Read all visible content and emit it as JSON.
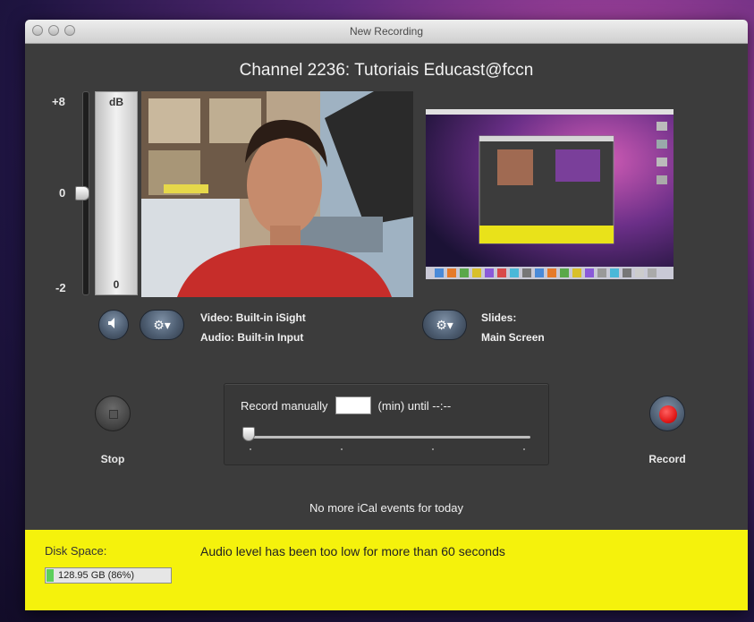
{
  "window": {
    "title": "New Recording"
  },
  "channel": {
    "title": "Channel 2236: Tutoriais Educast@fccn"
  },
  "meter": {
    "top_label": "+8",
    "mid_label": "0",
    "bottom_label": "-2",
    "bar_top": "dB",
    "bar_bottom": "0"
  },
  "video": {
    "line1_label": "Video:",
    "line1_value": "Built-in iSight",
    "line2_label": "Audio:",
    "line2_value": "Built-in Input"
  },
  "slides": {
    "label": "Slides:",
    "value": "Main Screen"
  },
  "controls": {
    "stop_label": "Stop",
    "record_label": "Record",
    "record_manually": "Record manually",
    "minutes_value": "",
    "min_until": "(min) until --:--"
  },
  "ical_text": "No more iCal events for today",
  "status": {
    "disk_label": "Disk Space:",
    "disk_value": "128.95 GB (86%)",
    "disk_fraction": 0.86,
    "warning": "Audio level has been too low for more than 60 seconds"
  },
  "colors": {
    "status_bg": "#f5f20c",
    "record_red": "#e21b1b",
    "disk_green": "#5ccf5c"
  },
  "icons": {
    "speaker": "speaker-icon",
    "gear": "gear-icon",
    "stop": "stop-icon",
    "record": "record-icon"
  }
}
